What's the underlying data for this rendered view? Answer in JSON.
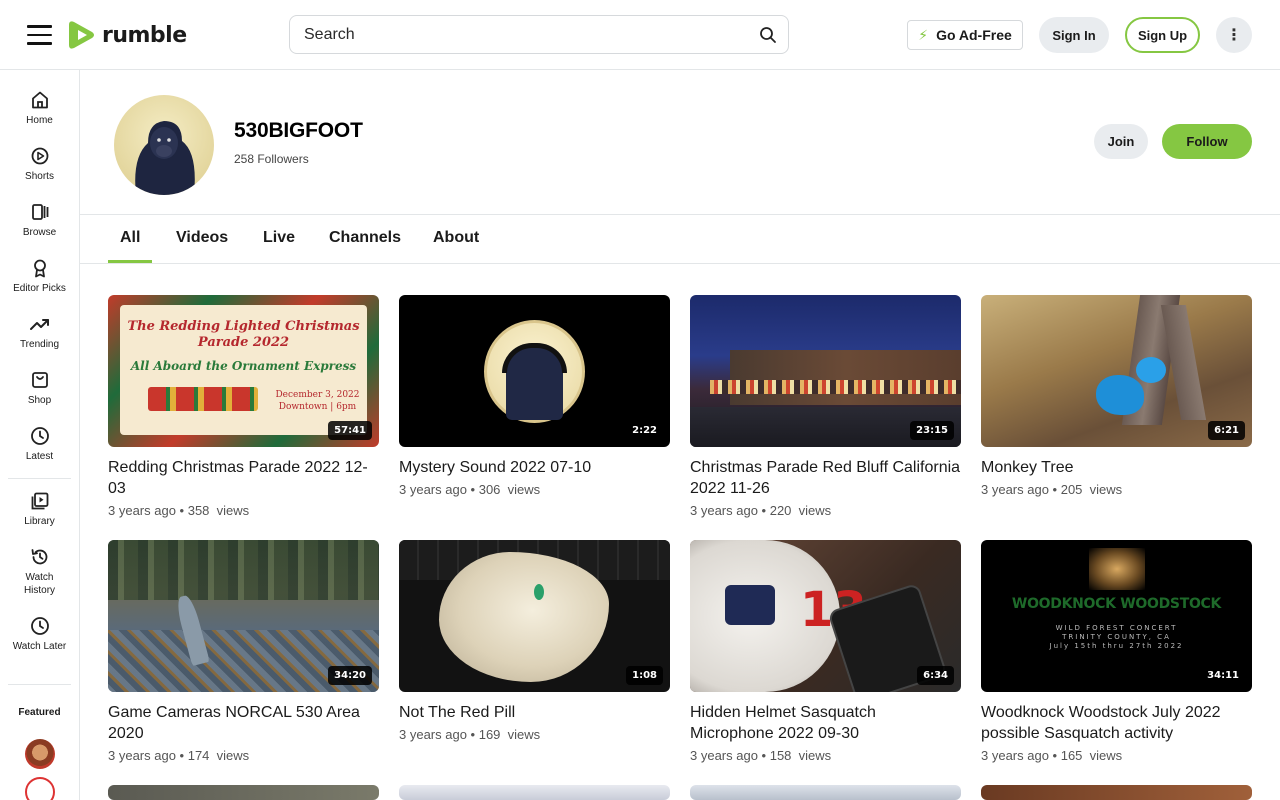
{
  "header": {
    "logo_text": "rumble",
    "search_placeholder": "Search",
    "go_ad_free": "Go Ad-Free",
    "sign_in": "Sign In",
    "sign_up": "Sign Up",
    "more_icon": "vertical-dots-icon",
    "brand_color": "#85c742"
  },
  "sidebar": {
    "items": [
      {
        "label": "Home",
        "icon": "home-icon"
      },
      {
        "label": "Shorts",
        "icon": "shorts-icon"
      },
      {
        "label": "Browse",
        "icon": "browse-icon"
      },
      {
        "label": "Editor Picks",
        "icon": "award-icon"
      },
      {
        "label": "Trending",
        "icon": "trending-icon"
      },
      {
        "label": "Shop",
        "icon": "shopping-bag-icon"
      },
      {
        "label": "Latest",
        "icon": "clock-icon"
      },
      {
        "label": "Library",
        "icon": "library-icon"
      },
      {
        "label": "Watch History",
        "icon": "history-icon"
      },
      {
        "label": "Watch Later",
        "icon": "clock-icon"
      }
    ],
    "featured_label": "Featured"
  },
  "channel": {
    "name": "530BIGFOOT",
    "followers": "258 Followers",
    "join": "Join",
    "follow": "Follow"
  },
  "tabs": [
    {
      "label": "All",
      "active": true
    },
    {
      "label": "Videos"
    },
    {
      "label": "Live"
    },
    {
      "label": "Channels"
    },
    {
      "label": "About"
    }
  ],
  "videos": [
    {
      "title": "Redding Christmas Parade 2022 12-03",
      "duration": "57:41",
      "age": "3 years ago",
      "views": "358",
      "views_label": "views",
      "thumb_text": [
        "The Redding Lighted Christmas",
        "Parade 2022",
        "All Aboard the Ornament Express",
        "December 3, 2022",
        "Downtown | 6pm"
      ]
    },
    {
      "title": "Mystery Sound 2022 07-10",
      "duration": "2:22",
      "age": "3 years ago",
      "views": "306",
      "views_label": "views"
    },
    {
      "title": "Christmas Parade Red Bluff California 2022 11-26",
      "duration": "23:15",
      "age": "3 years ago",
      "views": "220",
      "views_label": "views"
    },
    {
      "title": "Monkey Tree",
      "duration": "6:21",
      "age": "3 years ago",
      "views": "205",
      "views_label": "views"
    },
    {
      "title": "Game Cameras NORCAL 530 Area 2020",
      "duration": "34:20",
      "age": "3 years ago",
      "views": "174",
      "views_label": "views"
    },
    {
      "title": "Not The Red Pill",
      "duration": "1:08",
      "age": "3 years ago",
      "views": "169",
      "views_label": "views"
    },
    {
      "title": "Hidden Helmet Sasquatch Microphone 2022 09-30",
      "duration": "6:34",
      "age": "3 years ago",
      "views": "158",
      "views_label": "views"
    },
    {
      "title": "Woodknock Woodstock July 2022 possible Sasquatch activity",
      "duration": "34:11",
      "age": "3 years ago",
      "views": "165",
      "views_label": "views",
      "thumb_text": [
        "WOODKNOCK WOODSTOCK",
        "WILD FOREST CONCERT",
        "TRINITY COUNTY, CA",
        "July 15th thru 27th 2022"
      ]
    }
  ]
}
